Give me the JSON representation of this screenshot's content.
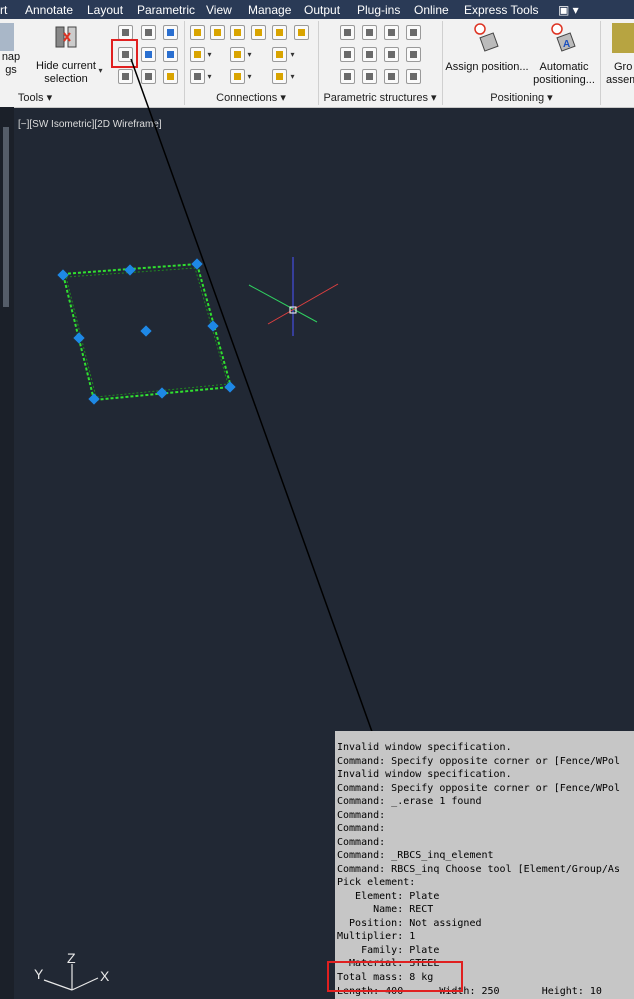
{
  "menubar": {
    "items": [
      "rt",
      "Annotate",
      "Layout",
      "Parametric",
      "View",
      "Manage",
      "Output",
      "Plug-ins",
      "Online",
      "Express Tools",
      "▣ ▾"
    ]
  },
  "ribbon": {
    "snap_label_1": "nap",
    "snap_label_2": "gs",
    "hide_label_1": "Hide current",
    "hide_label_2": "selection",
    "assign_label": "Assign position...",
    "auto_label_1": "Automatic",
    "auto_label_2": "positioning...",
    "group_label_1": "Gro",
    "group_label_2": "assem",
    "panels": [
      "Tools",
      "Connections",
      "Parametric structures",
      "Positioning"
    ],
    "panel_dropdown": "▾"
  },
  "viewport": {
    "label": "[−][SW Isometric][2D Wireframe]"
  },
  "command": {
    "lines": [
      "Invalid window specification.",
      "Command: Specify opposite corner or [Fence/WPol",
      "Invalid window specification.",
      "Command: Specify opposite corner or [Fence/WPol",
      "Command: _.erase 1 found",
      "Command:",
      "Command:",
      "Command:",
      "Command: _RBCS_inq_element",
      "Command: RBCS_inq Choose tool [Element/Group/As",
      "Pick element:",
      "   Element: Plate",
      "      Name: RECT",
      "  Position: Not assigned",
      "Multiplier: 1",
      "    Family: Plate",
      "  Material: STEEL",
      "Total mass: 8 kg",
      "Length: 400      Width: 250       Height: 10"
    ]
  },
  "ucs": {
    "y": "Y",
    "z": "Z",
    "x": "X"
  },
  "colors": {
    "menubar": "#2a3a56",
    "viewport": "#212834",
    "highlight": "#e02020",
    "selection": "#30e030",
    "grip": "#1e88e5"
  }
}
